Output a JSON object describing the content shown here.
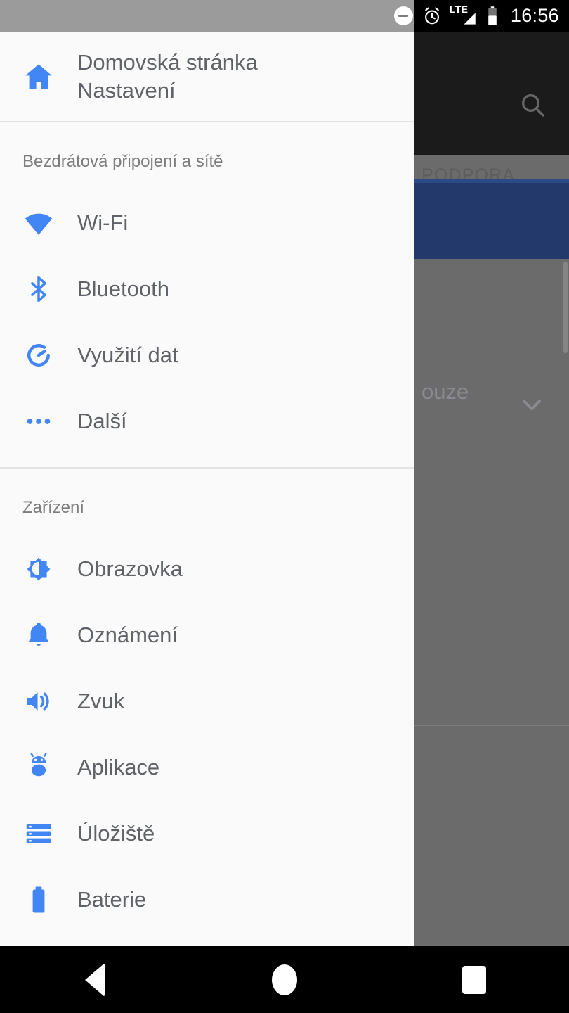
{
  "status_bar": {
    "time": "16:56",
    "icons": [
      {
        "name": "do-not-disturb-icon",
        "glyph": "minus-circle"
      },
      {
        "name": "alarm-icon",
        "glyph": "alarm-clock"
      },
      {
        "name": "network-type-label",
        "text": "LTE"
      },
      {
        "name": "signal-icon",
        "glyph": "signal-triangle"
      },
      {
        "name": "battery-icon",
        "glyph": "battery-half"
      }
    ],
    "network_label": "LTE"
  },
  "background_app": {
    "search_icon": "search-icon",
    "tab_label": "PODPORA",
    "row_label": "ouze",
    "expand_icon": "chevron-down-icon"
  },
  "drawer": {
    "header": {
      "icon": "home-icon",
      "title_line1": "Domovská stránka",
      "title_line2": "Nastavení",
      "title": "Domovská stránka Nastavení"
    },
    "sections": [
      {
        "title": "Bezdrátová připojení a sítě",
        "items": [
          {
            "label": "Wi-Fi",
            "icon": "wifi-icon"
          },
          {
            "label": "Bluetooth",
            "icon": "bluetooth-icon"
          },
          {
            "label": "Využití dat",
            "icon": "data-usage-icon"
          },
          {
            "label": "Další",
            "icon": "more-horizontal-icon"
          }
        ]
      },
      {
        "title": "Zařízení",
        "items": [
          {
            "label": "Obrazovka",
            "icon": "brightness-icon"
          },
          {
            "label": "Oznámení",
            "icon": "bell-icon"
          },
          {
            "label": "Zvuk",
            "icon": "volume-icon"
          },
          {
            "label": "Aplikace",
            "icon": "android-icon"
          },
          {
            "label": "Úložiště",
            "icon": "storage-icon"
          },
          {
            "label": "Baterie",
            "icon": "battery-icon"
          }
        ]
      }
    ]
  },
  "navigation_bar": {
    "back": "back-button",
    "home": "home-button",
    "recents": "recents-button"
  },
  "colors": {
    "accent_blue": "#4285F4",
    "drawer_bg": "#fafafa",
    "text_primary": "#5f6368",
    "text_secondary": "#7d7d7d",
    "appbar_dark": "#1b1b1b",
    "row_blue": "#23386b",
    "scrim_gray": "#6b6b6b"
  }
}
